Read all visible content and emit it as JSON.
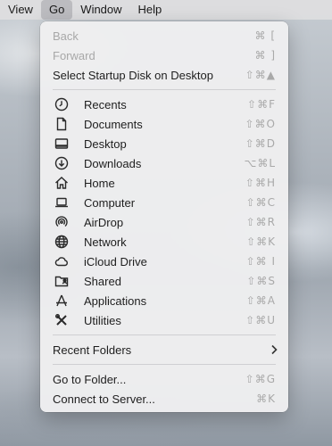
{
  "menubar": {
    "items": [
      "View",
      "Go",
      "Window",
      "Help"
    ]
  },
  "menu": {
    "back": {
      "label": "Back",
      "shortcut": "⌘ ["
    },
    "forward": {
      "label": "Forward",
      "shortcut": "⌘ ]"
    },
    "startup": {
      "label": "Select Startup Disk on Desktop",
      "shortcut": "⇧⌘▲"
    },
    "places": [
      {
        "label": "Recents",
        "shortcut": "⇧⌘F",
        "icon": "clock-icon"
      },
      {
        "label": "Documents",
        "shortcut": "⇧⌘O",
        "icon": "document-icon"
      },
      {
        "label": "Desktop",
        "shortcut": "⇧⌘D",
        "icon": "desktop-icon"
      },
      {
        "label": "Downloads",
        "shortcut": "⌥⌘L",
        "icon": "download-icon"
      },
      {
        "label": "Home",
        "shortcut": "⇧⌘H",
        "icon": "home-icon"
      },
      {
        "label": "Computer",
        "shortcut": "⇧⌘C",
        "icon": "laptop-icon"
      },
      {
        "label": "AirDrop",
        "shortcut": "⇧⌘R",
        "icon": "airdrop-icon"
      },
      {
        "label": "Network",
        "shortcut": "⇧⌘K",
        "icon": "globe-icon"
      },
      {
        "label": "iCloud Drive",
        "shortcut": "⇧⌘ I",
        "icon": "cloud-icon"
      },
      {
        "label": "Shared",
        "shortcut": "⇧⌘S",
        "icon": "shared-folder-icon"
      },
      {
        "label": "Applications",
        "shortcut": "⇧⌘A",
        "icon": "applications-icon"
      },
      {
        "label": "Utilities",
        "shortcut": "⇧⌘U",
        "icon": "tools-icon"
      }
    ],
    "recent_folders": {
      "label": "Recent Folders"
    },
    "go_to_folder": {
      "label": "Go to Folder...",
      "shortcut": "⇧⌘G"
    },
    "connect": {
      "label": "Connect to Server...",
      "shortcut": "⌘K"
    }
  }
}
